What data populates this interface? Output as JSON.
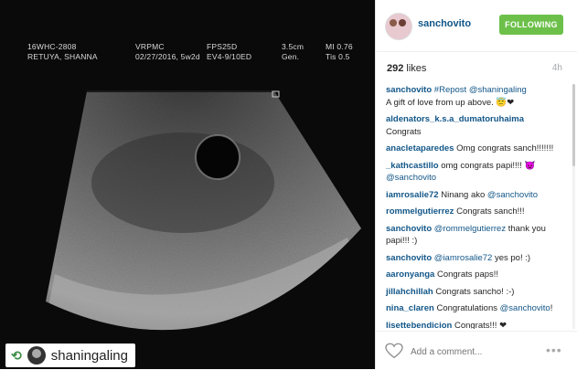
{
  "photo": {
    "overlay_text": {
      "left": "16WHC-2808\nRETUYA, SHANNA",
      "center": "VRPMC\n02/27/2016, 5w2d",
      "center2": "FPS25D\nEV4-9/10ED",
      "right1": "3.5cm\nGen.",
      "right2": "MI 0.76\nTis 0.5"
    },
    "repost": {
      "icon": "repost-icon",
      "username": "shaningaling"
    }
  },
  "post": {
    "username": "sanchovito",
    "follow_label": "FOLLOWING",
    "likes": "292",
    "likes_suffix": " likes",
    "time": "4h"
  },
  "comments": [
    {
      "user": "sanchovito",
      "text": " ",
      "mention": "#Repost @shaningaling",
      "text2": "\nA gift of love from up above. 😇❤"
    },
    {
      "user": "aldenators_k.s.a_dumatoruhaima",
      "text": " Congrats",
      "mention": "",
      "text2": ""
    },
    {
      "user": "anacletaparedes",
      "text": " Omg congrats sanch!!!!!!!",
      "mention": "",
      "text2": ""
    },
    {
      "user": "_kathcastillo",
      "text": " omg congrats papi!!!! 😈 ",
      "mention": "@sanchovito",
      "text2": ""
    },
    {
      "user": "iamrosalie72",
      "text": " Ninang ako ",
      "mention": "@sanchovito",
      "text2": ""
    },
    {
      "user": "rommelgutierrez",
      "text": " Congrats sanch!!!",
      "mention": "",
      "text2": ""
    },
    {
      "user": "sanchovito",
      "text": " ",
      "mention": "@rommelgutierrez",
      "text2": " thank you papi!!! :)"
    },
    {
      "user": "sanchovito",
      "text": " ",
      "mention": "@iamrosalie72",
      "text2": " yes po! :)"
    },
    {
      "user": "aaronyanga",
      "text": " Congrats paps!!",
      "mention": "",
      "text2": ""
    },
    {
      "user": "jillahchillah",
      "text": " Congrats sancho! :-)",
      "mention": "",
      "text2": ""
    },
    {
      "user": "nina_claren",
      "text": " Congratulations ",
      "mention": "@sanchovito",
      "text2": "!"
    },
    {
      "user": "lisettebendicion",
      "text": " Congrats!!! ❤",
      "mention": "",
      "text2": ""
    }
  ],
  "footer": {
    "placeholder": "Add a comment...",
    "more": "•••"
  }
}
